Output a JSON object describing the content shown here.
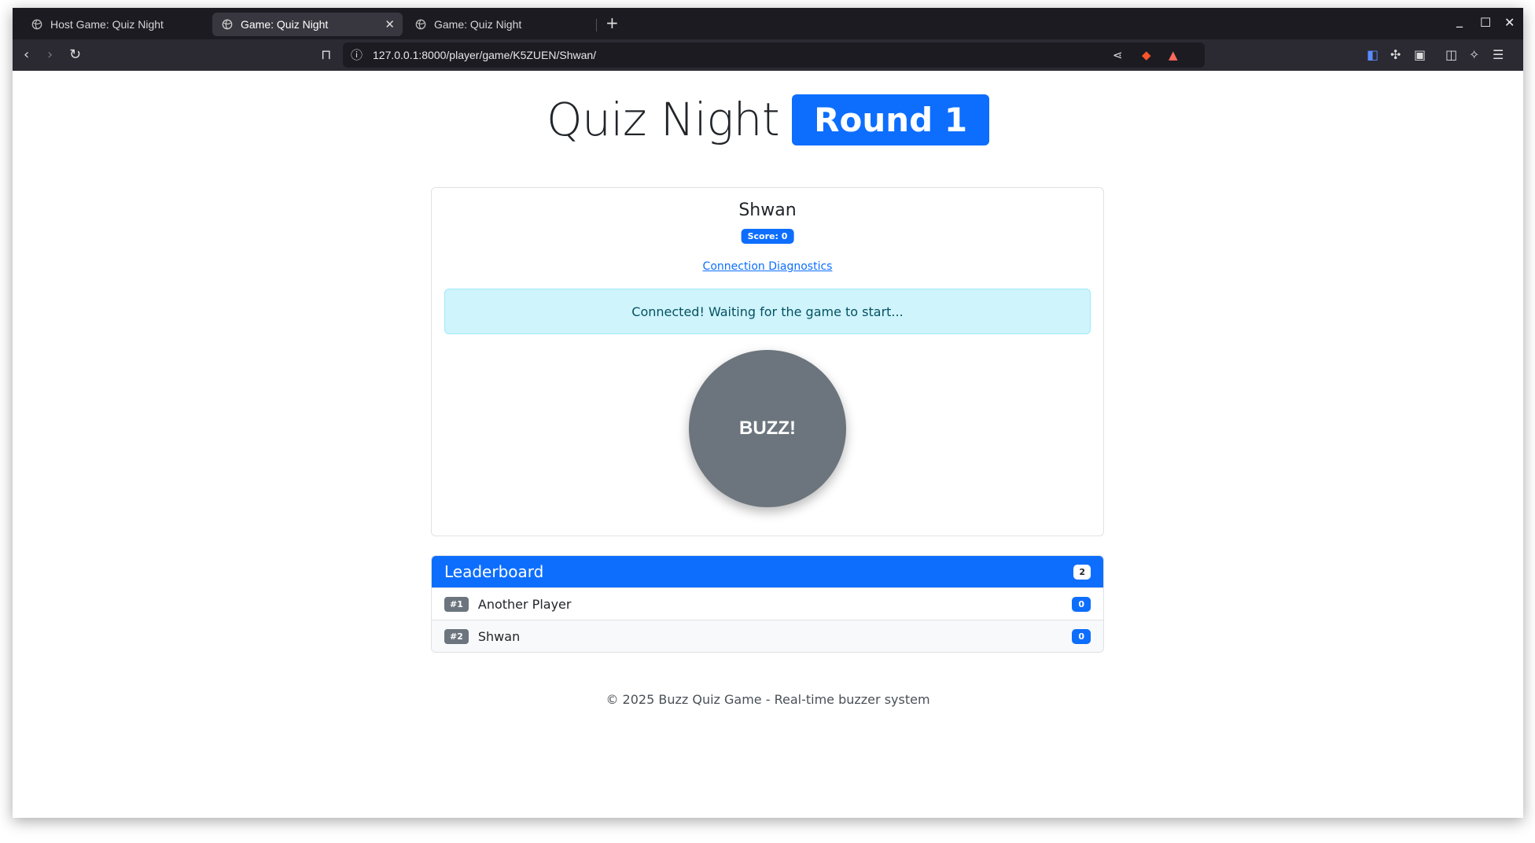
{
  "browser": {
    "tabs": [
      {
        "label": "Host Game: Quiz Night",
        "active": false
      },
      {
        "label": "Game: Quiz Night",
        "active": true
      },
      {
        "label": "Game: Quiz Night",
        "active": false
      }
    ],
    "url": "127.0.0.1:8000/player/game/K5ZUEN/Shwan/",
    "icons": [
      "back-icon",
      "forward-icon",
      "reload-icon",
      "bookmark-icon",
      "site-info-icon",
      "share-icon",
      "brave-shield-icon",
      "brave-rewards-icon",
      "bitwarden-icon",
      "extensions-icon",
      "wallet-icon",
      "sidebar-icon",
      "leo-ai-icon",
      "menu-icon"
    ]
  },
  "header": {
    "title": "Quiz Night",
    "round": "Round 1"
  },
  "player": {
    "name": "Shwan",
    "score_label": "Score: 0",
    "diagnostics_link": "Connection Diagnostics",
    "status_message": "Connected! Waiting for the game to start...",
    "buzz_label": "BUZZ!"
  },
  "leaderboard": {
    "title": "Leaderboard",
    "count": "2",
    "rows": [
      {
        "rank": "#1",
        "name": "Another Player",
        "score": "0"
      },
      {
        "rank": "#2",
        "name": "Shwan",
        "score": "0"
      }
    ]
  },
  "footer": {
    "text": "© 2025 Buzz Quiz Game - Real-time buzzer system"
  },
  "colors": {
    "primary": "#0d6efd",
    "secondary": "#6c757d",
    "info_bg": "#cff4fc"
  }
}
